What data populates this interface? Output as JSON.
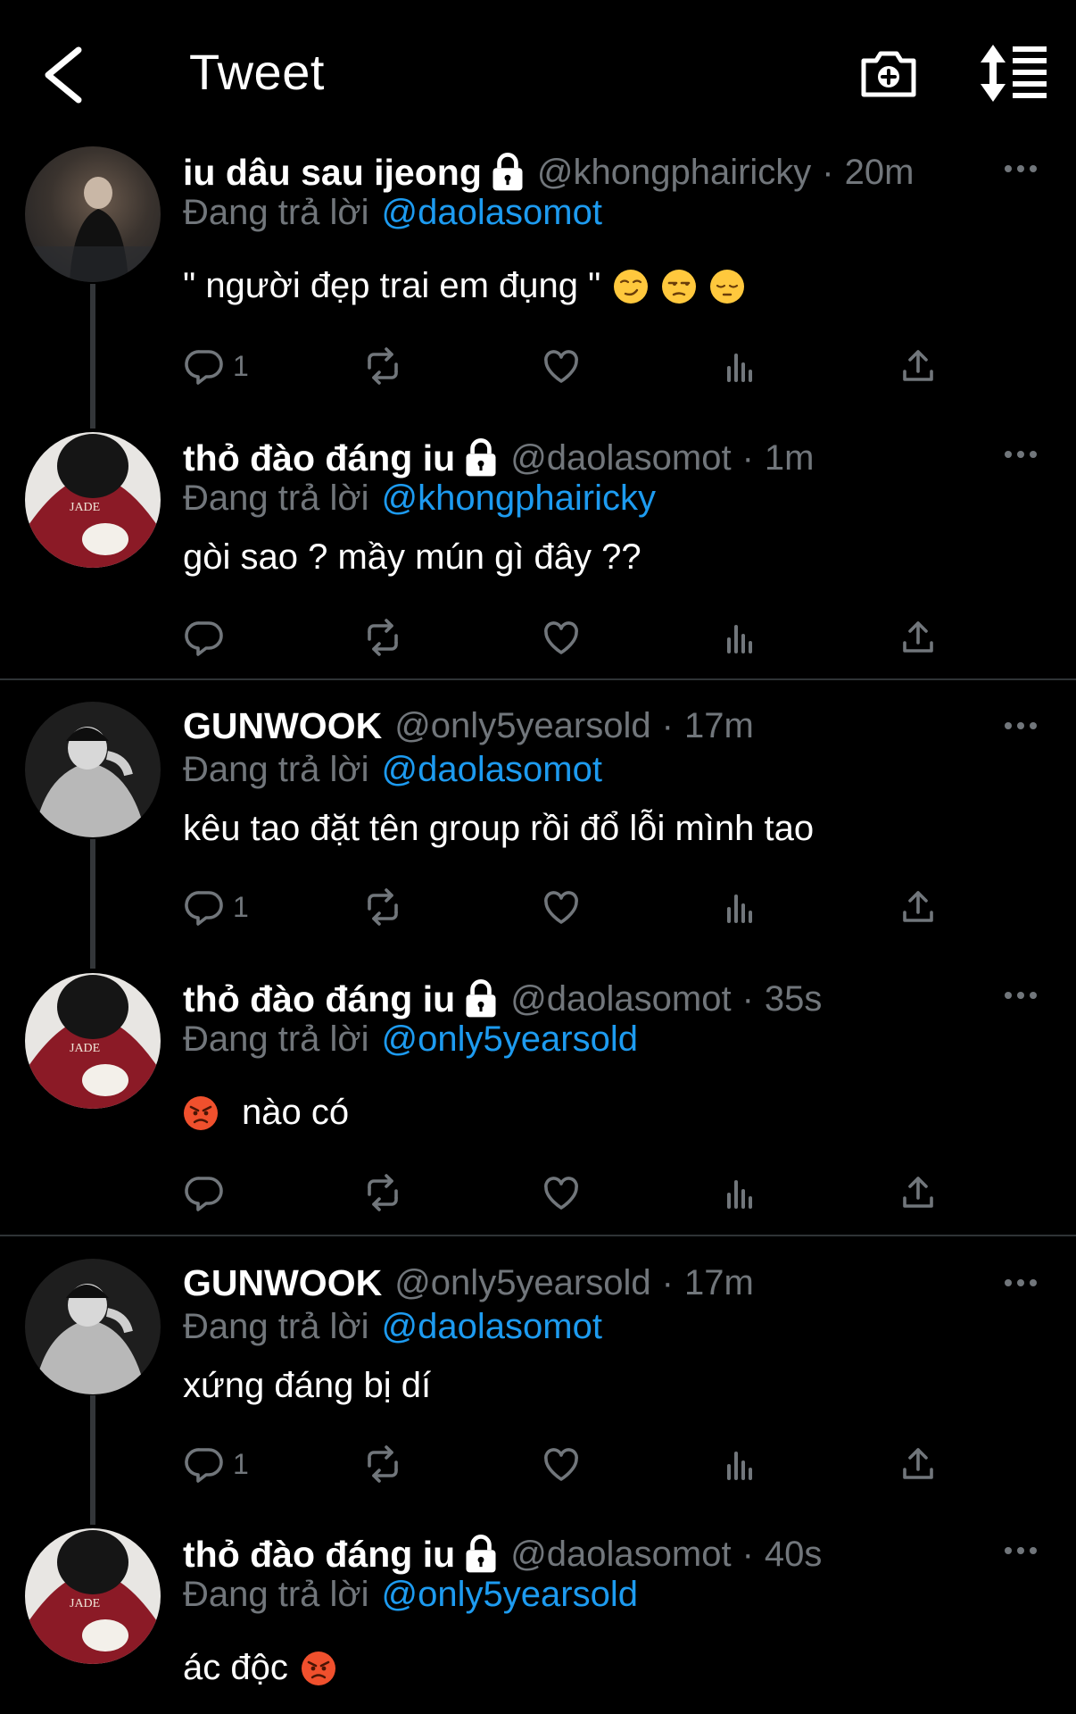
{
  "header": {
    "title": "Tweet"
  },
  "reply_label": "Đang trả lời",
  "tweets": [
    {
      "name": "iu dâu sau ijeong",
      "locked": true,
      "handle": "@khongphairicky",
      "dot": "·",
      "time": "20m",
      "reply_to": "@daolasomot",
      "text": "\" người đẹp trai em đụng \"",
      "reply_count": "1"
    },
    {
      "name": "thỏ đào đáng iu",
      "locked": true,
      "handle": "@daolasomot",
      "dot": "·",
      "time": "1m",
      "reply_to": "@khongphairicky",
      "text": "gòi sao ? mầy mún gì đây ??",
      "reply_count": ""
    },
    {
      "name": "GUNWOOK",
      "locked": false,
      "handle": "@only5yearsold",
      "dot": "·",
      "time": "17m",
      "reply_to": "@daolasomot",
      "text": "kêu tao đặt tên group rồi đổ lỗi mình tao",
      "reply_count": "1"
    },
    {
      "name": "thỏ đào đáng iu",
      "locked": true,
      "handle": "@daolasomot",
      "dot": "·",
      "time": "35s",
      "reply_to": "@only5yearsold",
      "text": "nào có",
      "reply_count": ""
    },
    {
      "name": "GUNWOOK",
      "locked": false,
      "handle": "@only5yearsold",
      "dot": "·",
      "time": "17m",
      "reply_to": "@daolasomot",
      "text": "xứng đáng bị dí",
      "reply_count": "1"
    },
    {
      "name": "thỏ đào đáng iu",
      "locked": true,
      "handle": "@daolasomot",
      "dot": "·",
      "time": "40s",
      "reply_to": "@only5yearsold",
      "text": "ác độc",
      "reply_count": ""
    }
  ],
  "icons": {
    "back": "chevron-left-icon",
    "camera": "camera-plus-icon",
    "sort": "sort-icon",
    "lock": "lock-icon",
    "more": "more-icon",
    "reply": "reply-icon",
    "retweet": "retweet-icon",
    "like": "heart-icon",
    "analytics": "analytics-icon",
    "share": "share-icon"
  },
  "colors": {
    "background": "#000000",
    "text": "#e7e9ea",
    "muted": "#71767b",
    "accent": "#1d9bf0",
    "divider": "#2f3336"
  }
}
